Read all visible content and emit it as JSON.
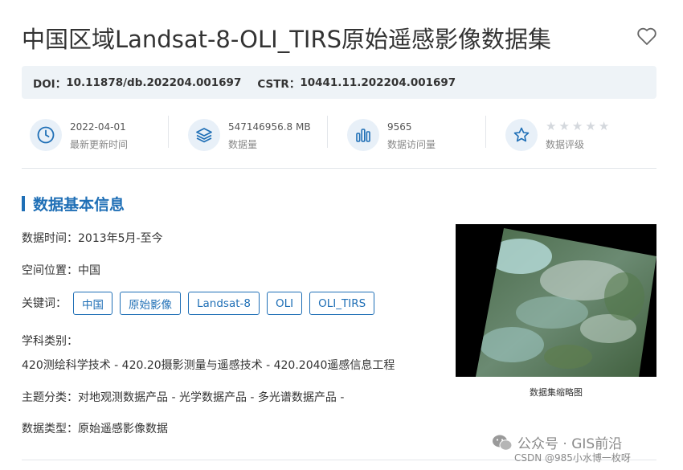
{
  "header": {
    "title": "中国区域Landsat-8-OLI_TIRS原始遥感影像数据集"
  },
  "identifiers": {
    "doi_label": "DOI：",
    "doi_value": "10.11878/db.202204.001697",
    "cstr_label": "CSTR：",
    "cstr_value": "10441.11.202204.001697"
  },
  "stats": {
    "update": {
      "value": "2022-04-01",
      "label": "最新更新时间"
    },
    "size": {
      "value": "547146956.8 MB",
      "label": "数据量"
    },
    "visits": {
      "value": "9565",
      "label": "数据访问量"
    },
    "rating": {
      "label": "数据评级",
      "stars": 0,
      "max_stars": 5
    }
  },
  "section": {
    "title": "数据基本信息"
  },
  "info": {
    "time_label": "数据时间：",
    "time_value": "2013年5月-至今",
    "location_label": "空间位置：",
    "location_value": "中国",
    "keywords_label": "关键词：",
    "keywords": [
      "中国",
      "原始影像",
      "Landsat-8",
      "OLI",
      "OLI_TIRS"
    ],
    "subject_label": "学科类别：",
    "subject_value": "420测绘科学技术 - 420.20摄影测量与遥感技术 - 420.2040遥感信息工程",
    "theme_label": "主题分类：",
    "theme_value": "对地观测数据产品 - 光学数据产品 - 多光谱数据产品 -",
    "type_label": "数据类型：",
    "type_value": "原始遥感影像数据"
  },
  "thumbnail": {
    "caption": "数据集缩略图"
  },
  "watermark": {
    "line1": "公众号 · GIS前沿",
    "line2": "CSDN @985小水博一枚呀"
  },
  "colors": {
    "accent": "#1f6fb6",
    "doi_bg": "#eef3f7",
    "icon_bg": "#e8f0f8",
    "star_off": "#d4d8dd"
  }
}
